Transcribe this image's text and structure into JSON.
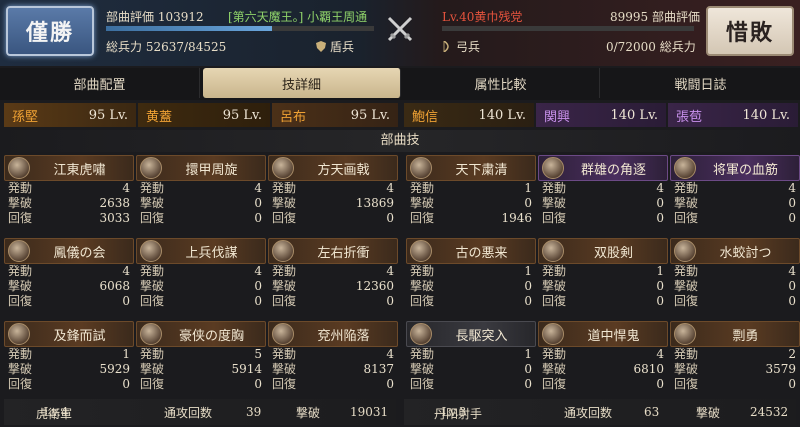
{
  "header": {
    "left": {
      "result": "僅勝",
      "rating_label": "部曲評価",
      "rating_value": "103912",
      "commander": "[第六天魔王。] 小覇王周通",
      "troops_label": "総兵力",
      "troops": "52637/84525",
      "unit_type": "盾兵"
    },
    "right": {
      "result": "惜敗",
      "commander": "Lv.40黄巾残党",
      "rating_value": "89995",
      "rating_label": "部曲評価",
      "unit_type": "弓兵",
      "troops": "0/72000",
      "troops_label": "総兵力"
    }
  },
  "tabs": [
    "部曲配置",
    "技詳細",
    "属性比較",
    "戦闘日誌"
  ],
  "leaders": [
    {
      "name": "孫堅",
      "level": "95 Lv."
    },
    {
      "name": "黄蓋",
      "level": "95 Lv."
    },
    {
      "name": "呂布",
      "level": "95 Lv."
    },
    {
      "name": "鮑信",
      "level": "140 Lv."
    },
    {
      "name": "関興",
      "level": "140 Lv."
    },
    {
      "name": "張苞",
      "level": "140 Lv."
    }
  ],
  "section_title": "部曲技",
  "stat_labels": {
    "activate": "発動",
    "kill": "撃破",
    "heal": "回復"
  },
  "skills_left": [
    [
      {
        "name": "江東虎嘯",
        "activate": "4",
        "kill": "2638",
        "heal": "3033"
      },
      {
        "name": "擐甲周旋",
        "activate": "4",
        "kill": "0",
        "heal": "0"
      },
      {
        "name": "方天画戟",
        "activate": "4",
        "kill": "13869",
        "heal": "0"
      }
    ],
    [
      {
        "name": "鳳儀の会",
        "activate": "4",
        "kill": "6068",
        "heal": "0"
      },
      {
        "name": "上兵伐謀",
        "activate": "4",
        "kill": "0",
        "heal": "0"
      },
      {
        "name": "左右折衝",
        "activate": "4",
        "kill": "12360",
        "heal": "0"
      }
    ],
    [
      {
        "name": "及鋒而試",
        "activate": "1",
        "kill": "5929",
        "heal": "0"
      },
      {
        "name": "豪侠の度胸",
        "activate": "5",
        "kill": "5914",
        "heal": "0"
      },
      {
        "name": "兗州陥落",
        "activate": "4",
        "kill": "8137",
        "heal": "0"
      }
    ]
  ],
  "skills_right": [
    [
      {
        "name": "天下粛清",
        "activate": "1",
        "kill": "0",
        "heal": "1946"
      },
      {
        "name": "群雄の角逐",
        "activate": "4",
        "kill": "0",
        "heal": "0"
      },
      {
        "name": "将軍の血筋",
        "activate": "4",
        "kill": "0",
        "heal": "0"
      }
    ],
    [
      {
        "name": "古の悪来",
        "activate": "1",
        "kill": "0",
        "heal": "0"
      },
      {
        "name": "双股剣",
        "activate": "1",
        "kill": "0",
        "heal": "0"
      },
      {
        "name": "水蛟討つ",
        "activate": "4",
        "kill": "0",
        "heal": "0"
      }
    ],
    [
      {
        "name": "長駆突入",
        "activate": "1",
        "kill": "0",
        "heal": "0"
      },
      {
        "name": "道中悍鬼",
        "activate": "4",
        "kill": "6810",
        "heal": "0"
      },
      {
        "name": "剽勇",
        "activate": "2",
        "kill": "3579",
        "heal": "0"
      }
    ]
  ],
  "footer": {
    "left": {
      "unit": "虎衛軍",
      "level": "Lv.4",
      "attacks_label": "通攻回数",
      "attacks": "39",
      "kills_label": "撃破",
      "kills": "19031"
    },
    "right": {
      "unit": "丹阳射手",
      "level": "Lv.3",
      "attacks_label": "通攻回数",
      "attacks": "63",
      "kills_label": "撃破",
      "kills": "24532"
    }
  },
  "colors": {
    "gold": "#f0a234",
    "purple": "#c991ec",
    "left_hp": "#5e94c8",
    "right_hp": "#c84a3c",
    "tab_active": "#d8c79f"
  }
}
